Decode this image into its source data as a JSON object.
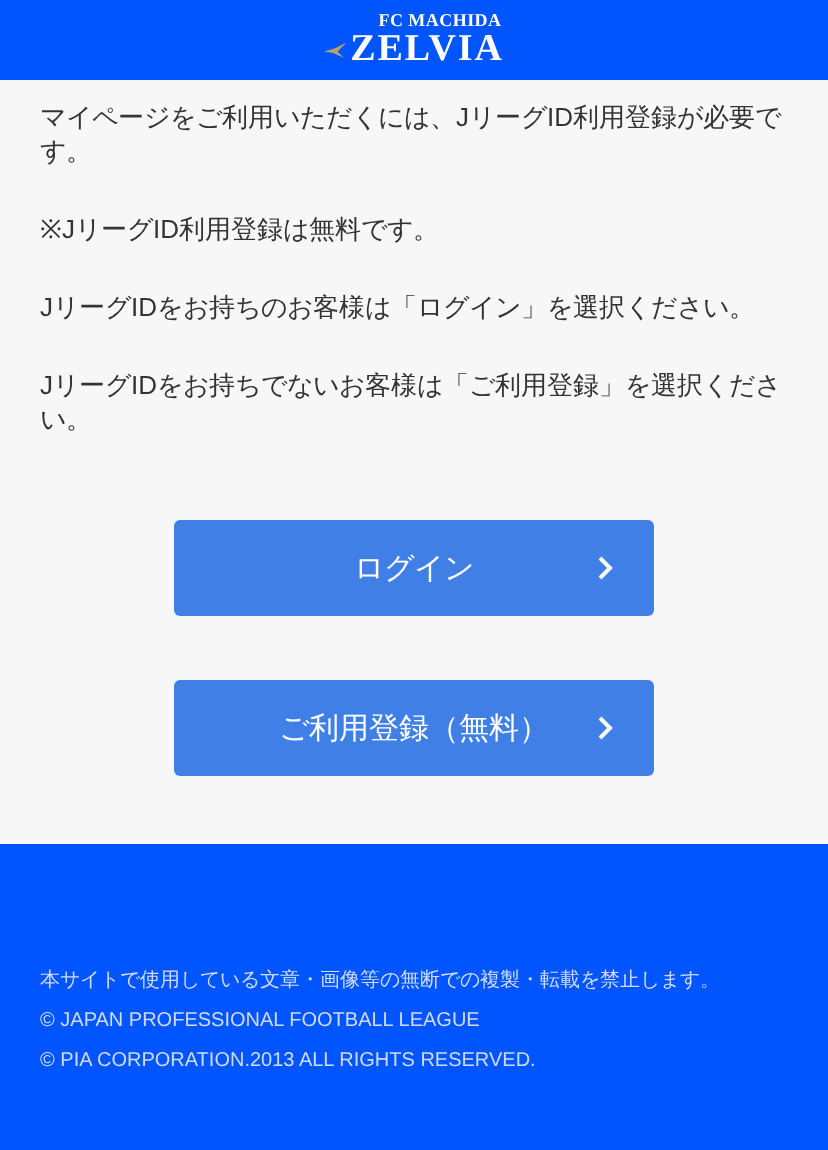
{
  "header": {
    "logo_top": "FC MACHIDA",
    "logo_main": "ZELVIA"
  },
  "paragraphs": [
    "マイページをご利用いただくには、JリーグID利用登録が必要です。",
    "※JリーグID利用登録は無料です。",
    "JリーグIDをお持ちのお客様は「ログイン」を選択ください。",
    "JリーグIDをお持ちでないお客様は「ご利用登録」を選択ください。"
  ],
  "buttons": [
    {
      "label": "ログイン"
    },
    {
      "label": "ご利用登録（無料）"
    }
  ],
  "footer": [
    "本サイトで使用している文章・画像等の無断での複製・転載を禁止します。",
    "© JAPAN PROFESSIONAL FOOTBALL LEAGUE",
    "© PIA CORPORATION.2013 ALL RIGHTS RESERVED."
  ]
}
